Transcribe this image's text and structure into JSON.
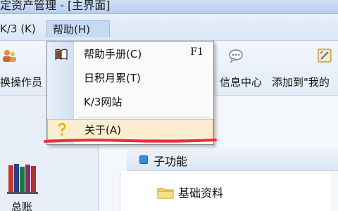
{
  "window": {
    "title": "定资产管理 - [主界面]"
  },
  "menubar": {
    "items": [
      {
        "label": "K/3 (K)"
      },
      {
        "label": "帮助(H)"
      }
    ]
  },
  "toolbar": {
    "operator_label": "换操作员",
    "message_center_label": "信息中心",
    "add_to_label": "添加到\"我的"
  },
  "help_menu": {
    "items": [
      {
        "label": "帮助手册(C)",
        "shortcut": "F1"
      },
      {
        "label": "日积月累(T)",
        "shortcut": ""
      },
      {
        "label": "K/3网站",
        "shortcut": ""
      },
      {
        "label": "关于(A)",
        "shortcut": ""
      }
    ],
    "selected_index": 3,
    "highlight_color": "#e8303a"
  },
  "nav": {
    "label": "总账"
  },
  "content": {
    "section_title": "子功能",
    "folder_label": "基础资料"
  }
}
